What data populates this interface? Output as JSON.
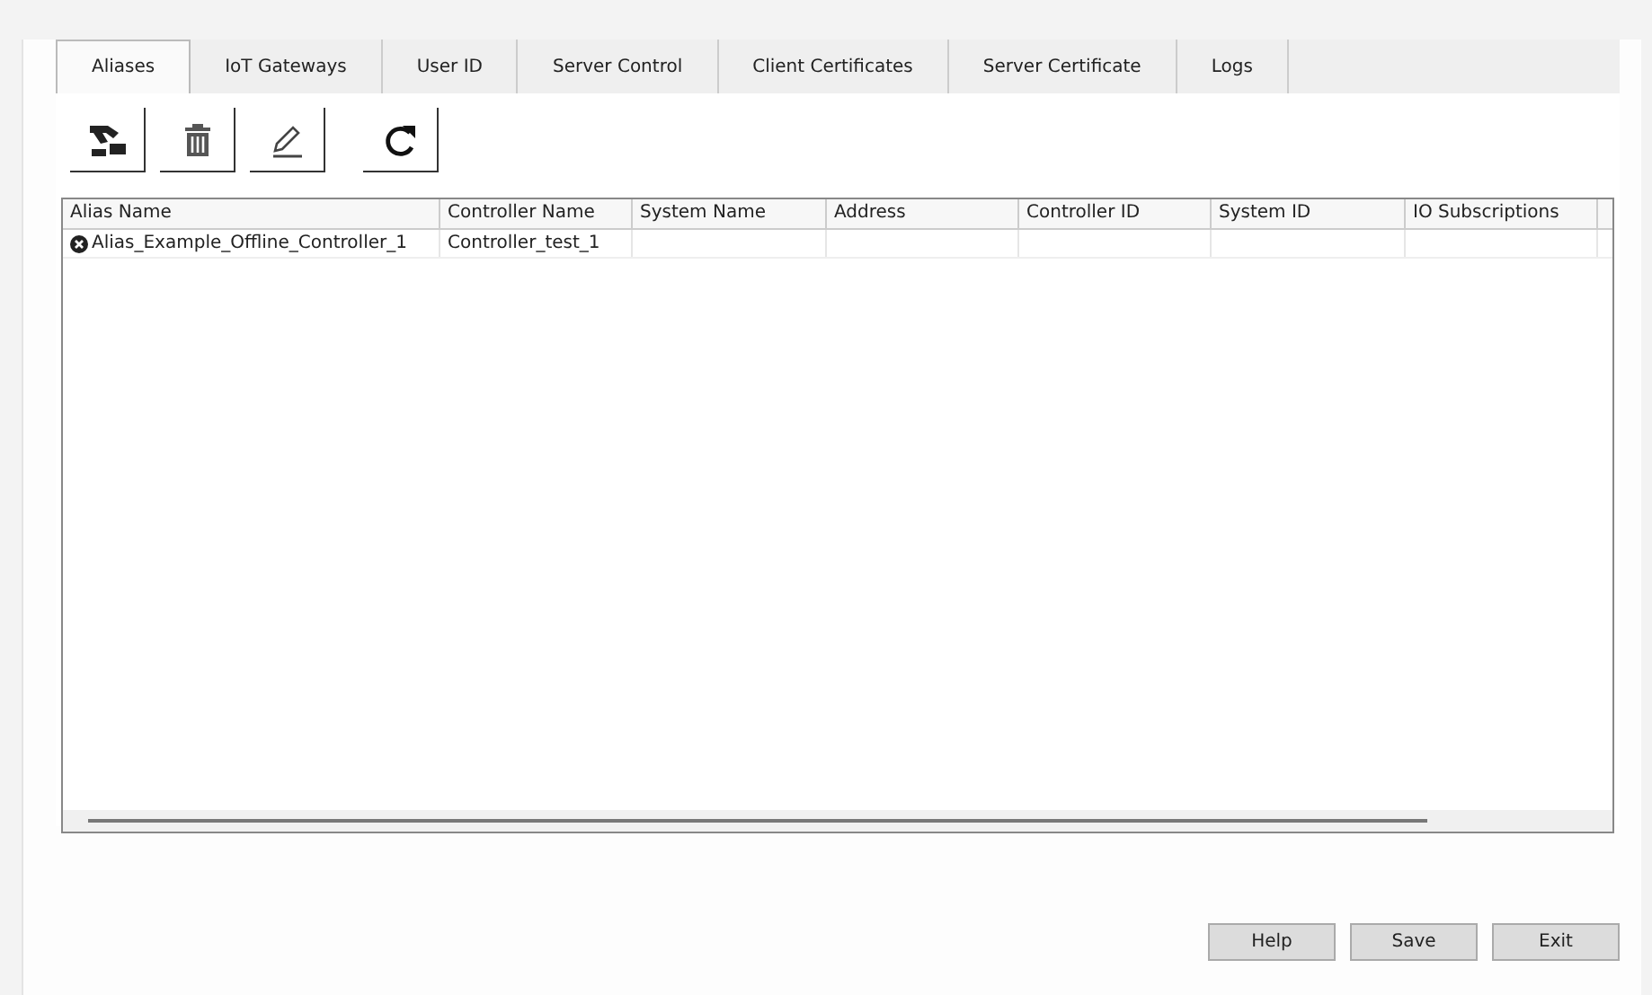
{
  "tabs": [
    {
      "label": "Aliases",
      "selected": true
    },
    {
      "label": "IoT Gateways",
      "selected": false
    },
    {
      "label": "User ID",
      "selected": false
    },
    {
      "label": "Server Control",
      "selected": false
    },
    {
      "label": "Client Certificates",
      "selected": false
    },
    {
      "label": "Server Certificate",
      "selected": false
    },
    {
      "label": "Logs",
      "selected": false
    }
  ],
  "toolbar": [
    {
      "kind": "add-robot"
    },
    {
      "kind": "delete"
    },
    {
      "kind": "edit"
    },
    {
      "kind": "refresh"
    }
  ],
  "table": {
    "columns": [
      "Alias Name",
      "Controller Name",
      "System Name",
      "Address",
      "Controller ID",
      "System ID",
      "IO Subscriptions"
    ],
    "rows": [
      {
        "cells": [
          "Alias_Example_Offline_Controller_1",
          "Controller_test_1",
          "",
          "",
          "",
          "",
          ""
        ]
      }
    ]
  },
  "buttons": [
    "Help",
    "Save",
    "Exit"
  ]
}
